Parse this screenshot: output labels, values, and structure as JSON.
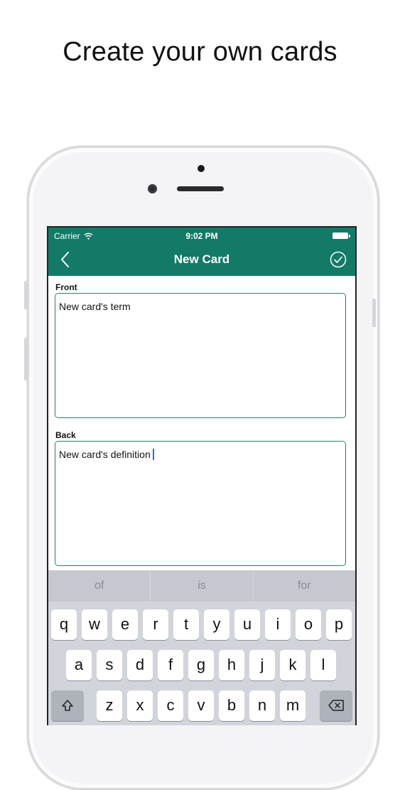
{
  "headline": "Create your own cards",
  "status_bar": {
    "carrier": "Carrier",
    "time": "9:02 PM"
  },
  "navbar": {
    "title": "New Card",
    "back_icon": "chevron-left-icon",
    "done_icon": "checkmark-circle-icon"
  },
  "form": {
    "front_label": "Front",
    "front_value": "New card's term",
    "back_label": "Back",
    "back_value": "New card's definition"
  },
  "keyboard": {
    "suggestions": [
      "of",
      "is",
      "for"
    ],
    "row1": [
      "q",
      "w",
      "e",
      "r",
      "t",
      "y",
      "u",
      "i",
      "o",
      "p"
    ],
    "row2": [
      "a",
      "s",
      "d",
      "f",
      "g",
      "h",
      "j",
      "k",
      "l"
    ],
    "row3": [
      "z",
      "x",
      "c",
      "v",
      "b",
      "n",
      "m"
    ]
  },
  "colors": {
    "accent": "#137a68",
    "field_border": "#2a7f6a",
    "cursor": "#2b6de0"
  }
}
